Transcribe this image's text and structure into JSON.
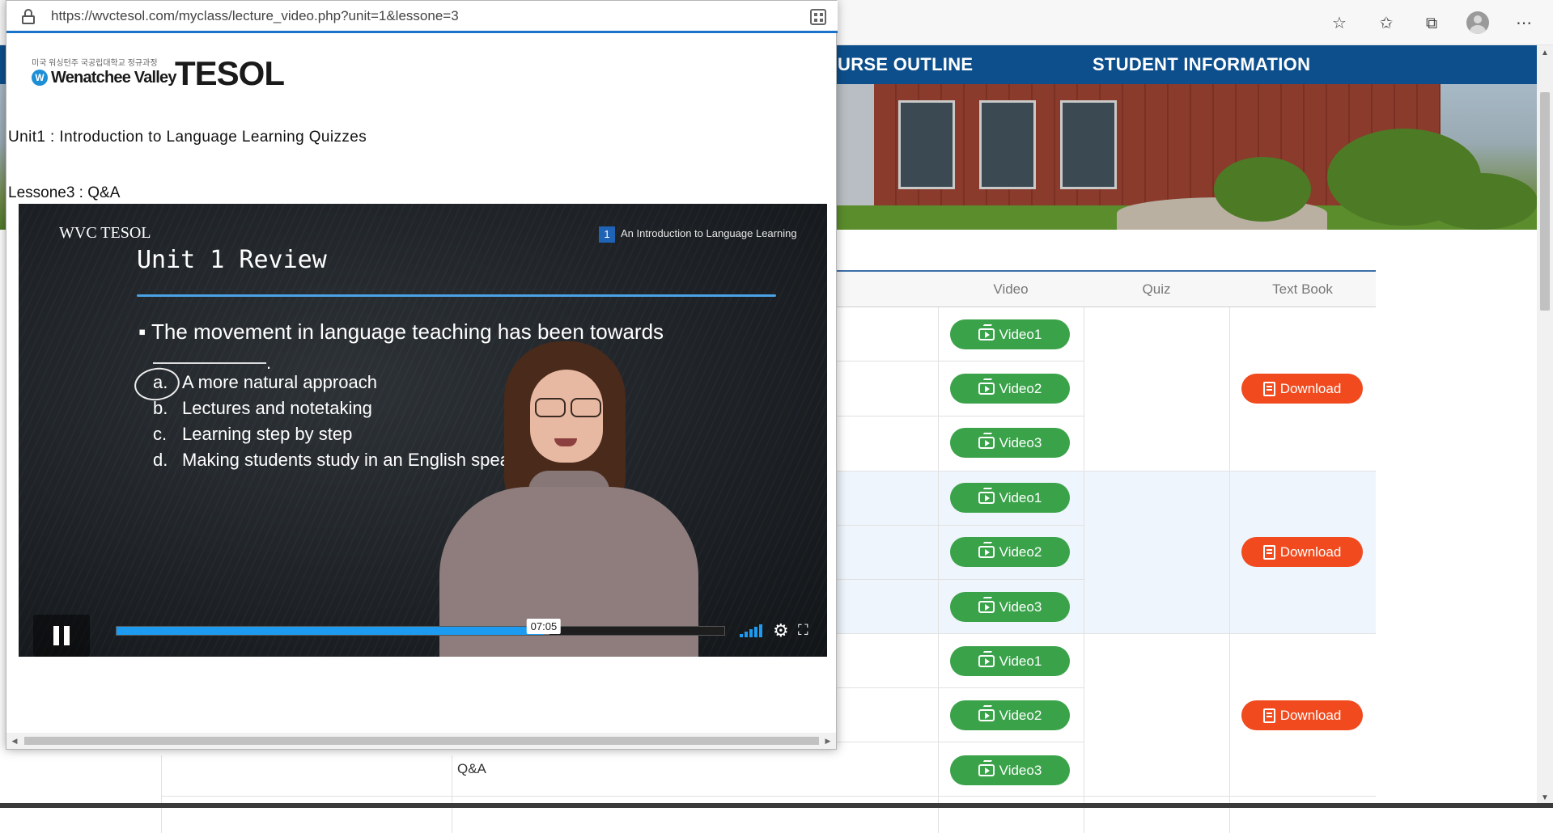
{
  "site": {
    "nav": [
      "URSE OUTLINE",
      "STUDENT INFORMATION"
    ]
  },
  "browser_toolbar": {
    "icons": [
      "favorite-add-icon",
      "favorites-icon",
      "collections-icon",
      "profile-avatar",
      "more-icon"
    ]
  },
  "table": {
    "headers": {
      "video": "Video",
      "quiz": "Quiz",
      "textbook": "Text Book"
    },
    "groups": [
      {
        "videos": [
          "Video1",
          "Video2",
          "Video3"
        ],
        "download": "Download"
      },
      {
        "videos": [
          "Video1",
          "Video2",
          "Video3"
        ],
        "download": "Download"
      },
      {
        "videos": [
          "Video1",
          "Video2",
          "Video3"
        ],
        "download": "Download"
      }
    ],
    "last_row_label": "Q&A"
  },
  "popup": {
    "url": "https://wvctesol.com/myclass/lecture_video.php?unit=1&lessone=3",
    "logo": {
      "korean": "미국 워싱턴주 국공립대학교 정규과정",
      "college": "Wenatchee Valley",
      "program": "TESOL",
      "mark": "W"
    },
    "unit_title": "Unit1 : Introduction to Language Learning Quizzes",
    "lesson_title": "Lessone3 : Q&A"
  },
  "video": {
    "slide": {
      "logo": "WVC TESOL",
      "badge": "1",
      "chapter": "An Introduction to Language Learning",
      "heading": "Unit 1 Review",
      "bullet": "▪ The movement in language teaching has been towards",
      "blank_tail": ".",
      "options": [
        {
          "letter": "a.",
          "text": "A more natural approach"
        },
        {
          "letter": "b.",
          "text": "Lectures and notetaking"
        },
        {
          "letter": "c.",
          "text": "Learning step by step"
        },
        {
          "letter": "d.",
          "text": "Making students study in an English speak"
        }
      ]
    },
    "player": {
      "time_tooltip": "07:05",
      "progress_fraction": 0.703,
      "buffered_fraction": 0.712,
      "accent_color": "#1d9bf0"
    }
  }
}
